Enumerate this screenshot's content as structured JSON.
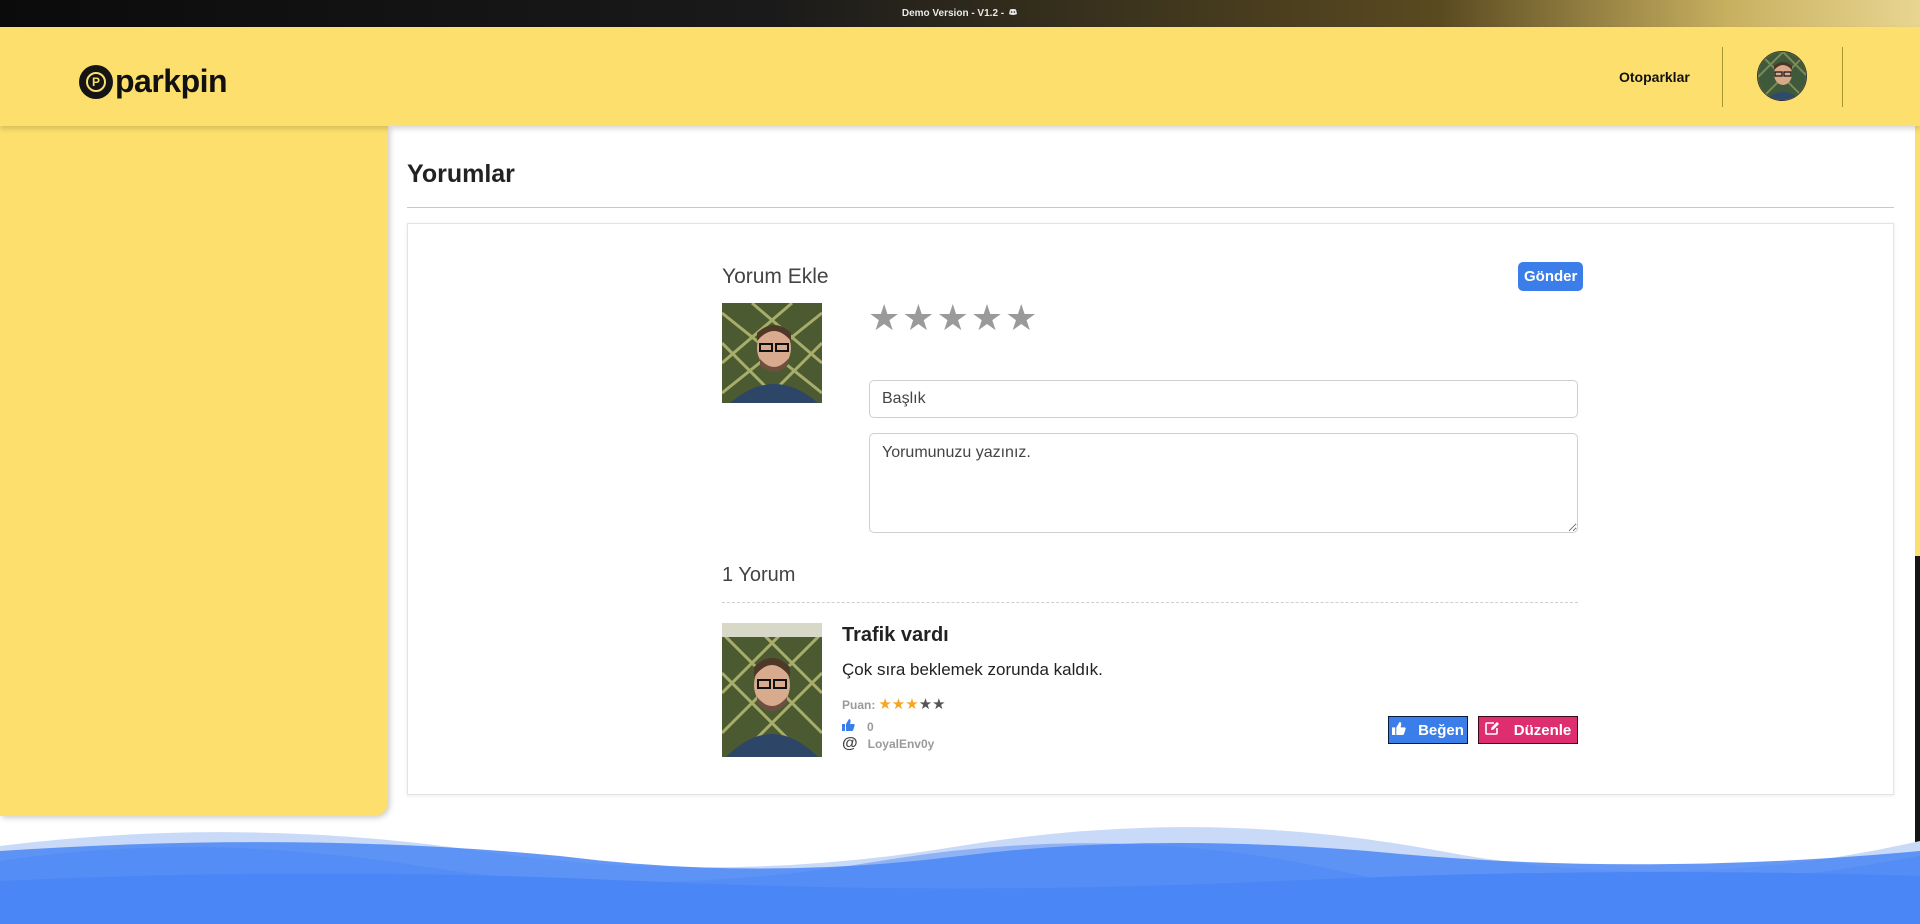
{
  "demo_bar": {
    "text": "Demo Version - V1.2 -"
  },
  "header": {
    "logo_text": "parkpin",
    "logo_glyph": "P",
    "nav_link": "Otoparklar",
    "avatar_icon": "user-avatar"
  },
  "page": {
    "title": "Yorumlar"
  },
  "add_comment": {
    "title": "Yorum Ekle",
    "send_label": "Gönder",
    "rating_stars": [
      "★",
      "★",
      "★",
      "★",
      "★"
    ],
    "title_placeholder": "Başlık",
    "comment_placeholder": "Yorumunuzu yazınız."
  },
  "comments": {
    "count_label": "1 Yorum",
    "items": [
      {
        "title": "Trafik vardı",
        "text": "Çok sıra beklemek zorunda kaldık.",
        "score_label": "Puan:",
        "score": 3,
        "score_max": 5,
        "likes": "0",
        "user_at": "@",
        "username": "LoyalEnv0y",
        "like_label": "Beğen",
        "edit_label": "Düzenle"
      }
    ]
  },
  "colors": {
    "brand_yellow": "#fcdf6c",
    "primary_blue": "#3b7de9",
    "edit_pink": "#de2e70",
    "star_filled": "#f5a623",
    "star_empty": "#555555",
    "star_inactive": "#9a9a9a",
    "wave_blue": "#4a86f5"
  }
}
